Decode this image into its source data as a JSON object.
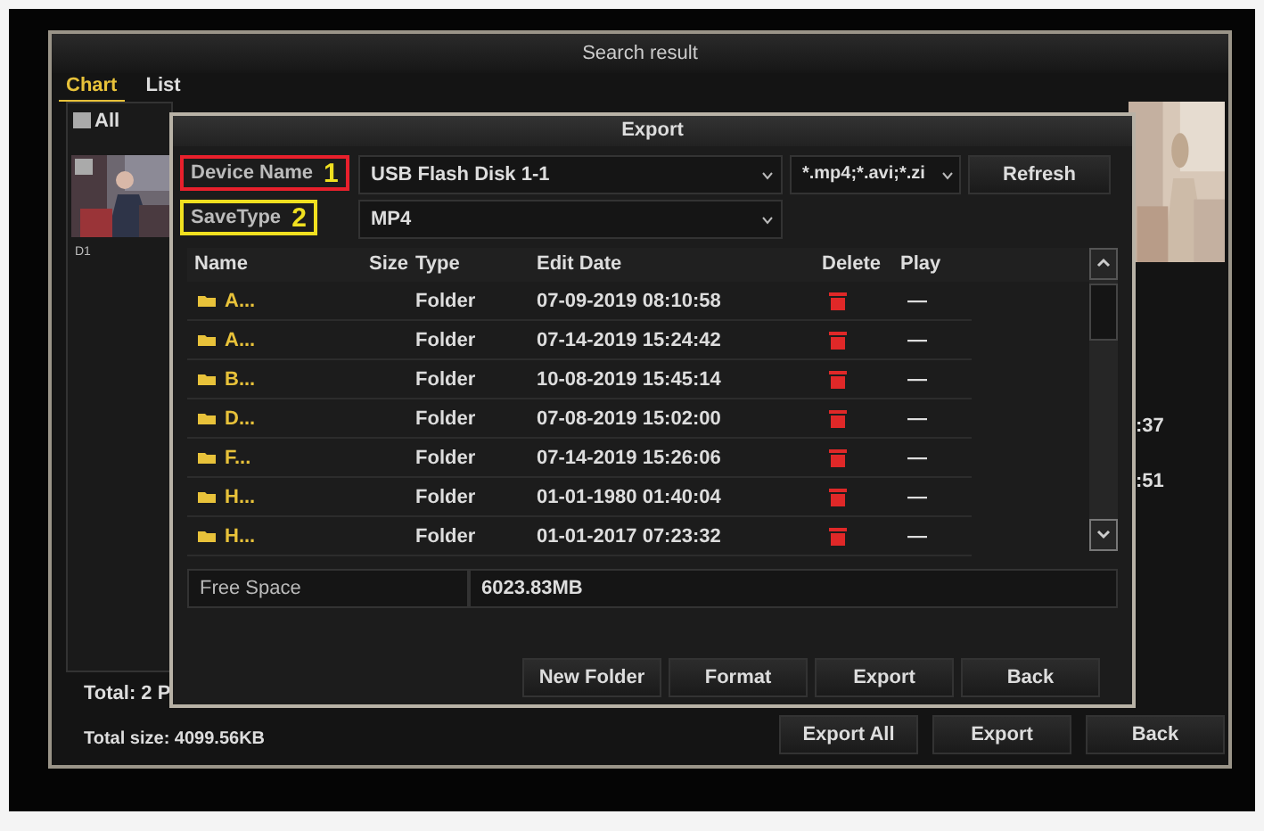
{
  "window": {
    "title": "Search result"
  },
  "tabs": [
    {
      "label": "Chart",
      "selected": true
    },
    {
      "label": "List",
      "selected": false
    }
  ],
  "select_all": {
    "label": "All",
    "checked": false
  },
  "thumbnail": {
    "kind": "picture",
    "checked": false,
    "caption": "D1"
  },
  "side_times": [
    ":37",
    ":51"
  ],
  "total": "Total: 2  P",
  "total_size": "Total size: 4099.56KB",
  "buttons": [
    "Export All",
    "Export",
    "Back"
  ],
  "export_dialog": {
    "title": "Export",
    "device_name": {
      "label": "Device Name",
      "annotation": "1",
      "color": "#e8202c",
      "value": "USB Flash Disk 1-1"
    },
    "filter": "*.mp4;*.avi;*.zi",
    "refresh": "Refresh",
    "save_type": {
      "label": "SaveType",
      "annotation": "2",
      "color": "#f0e020",
      "value": "MP4"
    },
    "columns": [
      "Name",
      "Size",
      "Type",
      "Edit Date",
      "Delete",
      "Play"
    ],
    "rows": [
      {
        "name": "A...",
        "type": "Folder",
        "date": "07-09-2019 08:10:58",
        "play": "—"
      },
      {
        "name": "A...",
        "type": "Folder",
        "date": "07-14-2019 15:24:42",
        "play": "—"
      },
      {
        "name": "B...",
        "type": "Folder",
        "date": "10-08-2019 15:45:14",
        "play": "—"
      },
      {
        "name": "D...",
        "type": "Folder",
        "date": "07-08-2019 15:02:00",
        "play": "—"
      },
      {
        "name": "F...",
        "type": "Folder",
        "date": "07-14-2019 15:26:06",
        "play": "—"
      },
      {
        "name": "H...",
        "type": "Folder",
        "date": "01-01-1980 01:40:04",
        "play": "—"
      },
      {
        "name": "H...",
        "type": "Folder",
        "date": "01-01-2017 07:23:32",
        "play": "—"
      }
    ],
    "free_space": {
      "label": "Free Space",
      "value": "6023.83MB"
    },
    "buttons": [
      "New Folder",
      "Format",
      "Export",
      "Back"
    ]
  }
}
